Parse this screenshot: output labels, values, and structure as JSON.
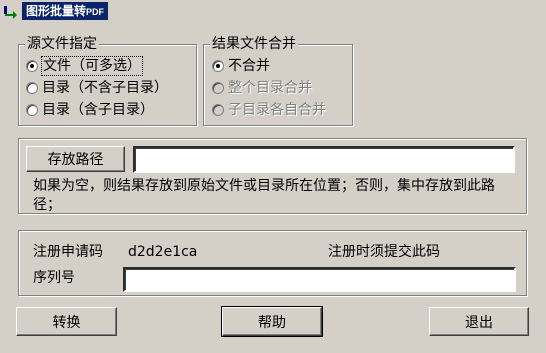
{
  "window": {
    "title": "图形批量转",
    "title_suffix": "PDF",
    "icon": "app-arrow-icon"
  },
  "source": {
    "legend": "源文件指定",
    "options": [
      {
        "label": "文件（可多选）",
        "checked": true
      },
      {
        "label": "目录（不含子目录）",
        "checked": false
      },
      {
        "label": "目录（含子目录）",
        "checked": false
      }
    ]
  },
  "merge": {
    "legend": "结果文件合并",
    "options": [
      {
        "label": "不合并",
        "checked": true,
        "disabled": false
      },
      {
        "label": "整个目录合并",
        "checked": false,
        "disabled": true
      },
      {
        "label": "子目录各自合并",
        "checked": false,
        "disabled": true
      }
    ]
  },
  "output": {
    "button_label": "存放路径",
    "path_value": "",
    "hint": "如果为空，则结果存放到原始文件或目录所在位置；否则，集中存放到此路径；"
  },
  "registration": {
    "request_label": "注册申请码",
    "request_code": "d2d2e1ca",
    "request_note": "注册时须提交此码",
    "serial_label": "序列号",
    "serial_value": ""
  },
  "actions": {
    "convert": "转换",
    "help": "帮助",
    "exit": "退出"
  }
}
